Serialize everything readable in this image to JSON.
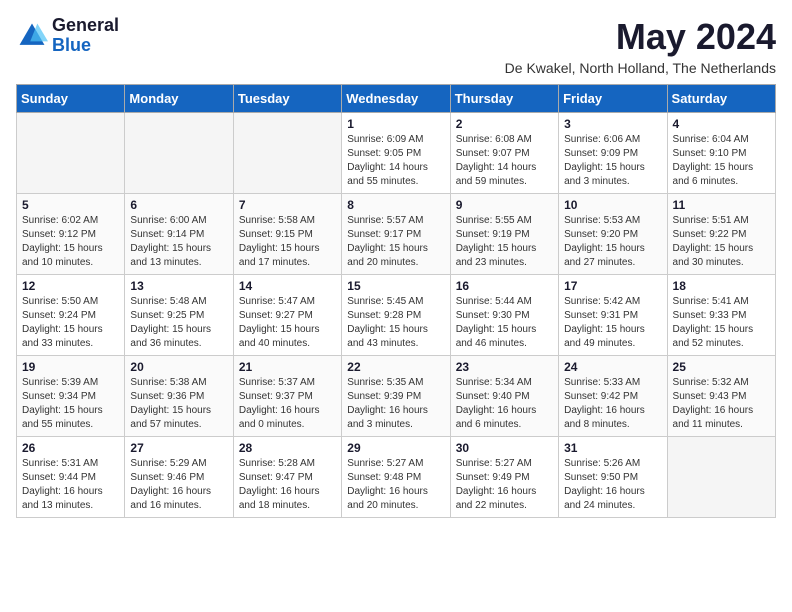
{
  "logo": {
    "general": "General",
    "blue": "Blue"
  },
  "title": "May 2024",
  "location": "De Kwakel, North Holland, The Netherlands",
  "days_of_week": [
    "Sunday",
    "Monday",
    "Tuesday",
    "Wednesday",
    "Thursday",
    "Friday",
    "Saturday"
  ],
  "weeks": [
    [
      {
        "day": "",
        "info": ""
      },
      {
        "day": "",
        "info": ""
      },
      {
        "day": "",
        "info": ""
      },
      {
        "day": "1",
        "info": "Sunrise: 6:09 AM\nSunset: 9:05 PM\nDaylight: 14 hours and 55 minutes."
      },
      {
        "day": "2",
        "info": "Sunrise: 6:08 AM\nSunset: 9:07 PM\nDaylight: 14 hours and 59 minutes."
      },
      {
        "day": "3",
        "info": "Sunrise: 6:06 AM\nSunset: 9:09 PM\nDaylight: 15 hours and 3 minutes."
      },
      {
        "day": "4",
        "info": "Sunrise: 6:04 AM\nSunset: 9:10 PM\nDaylight: 15 hours and 6 minutes."
      }
    ],
    [
      {
        "day": "5",
        "info": "Sunrise: 6:02 AM\nSunset: 9:12 PM\nDaylight: 15 hours and 10 minutes."
      },
      {
        "day": "6",
        "info": "Sunrise: 6:00 AM\nSunset: 9:14 PM\nDaylight: 15 hours and 13 minutes."
      },
      {
        "day": "7",
        "info": "Sunrise: 5:58 AM\nSunset: 9:15 PM\nDaylight: 15 hours and 17 minutes."
      },
      {
        "day": "8",
        "info": "Sunrise: 5:57 AM\nSunset: 9:17 PM\nDaylight: 15 hours and 20 minutes."
      },
      {
        "day": "9",
        "info": "Sunrise: 5:55 AM\nSunset: 9:19 PM\nDaylight: 15 hours and 23 minutes."
      },
      {
        "day": "10",
        "info": "Sunrise: 5:53 AM\nSunset: 9:20 PM\nDaylight: 15 hours and 27 minutes."
      },
      {
        "day": "11",
        "info": "Sunrise: 5:51 AM\nSunset: 9:22 PM\nDaylight: 15 hours and 30 minutes."
      }
    ],
    [
      {
        "day": "12",
        "info": "Sunrise: 5:50 AM\nSunset: 9:24 PM\nDaylight: 15 hours and 33 minutes."
      },
      {
        "day": "13",
        "info": "Sunrise: 5:48 AM\nSunset: 9:25 PM\nDaylight: 15 hours and 36 minutes."
      },
      {
        "day": "14",
        "info": "Sunrise: 5:47 AM\nSunset: 9:27 PM\nDaylight: 15 hours and 40 minutes."
      },
      {
        "day": "15",
        "info": "Sunrise: 5:45 AM\nSunset: 9:28 PM\nDaylight: 15 hours and 43 minutes."
      },
      {
        "day": "16",
        "info": "Sunrise: 5:44 AM\nSunset: 9:30 PM\nDaylight: 15 hours and 46 minutes."
      },
      {
        "day": "17",
        "info": "Sunrise: 5:42 AM\nSunset: 9:31 PM\nDaylight: 15 hours and 49 minutes."
      },
      {
        "day": "18",
        "info": "Sunrise: 5:41 AM\nSunset: 9:33 PM\nDaylight: 15 hours and 52 minutes."
      }
    ],
    [
      {
        "day": "19",
        "info": "Sunrise: 5:39 AM\nSunset: 9:34 PM\nDaylight: 15 hours and 55 minutes."
      },
      {
        "day": "20",
        "info": "Sunrise: 5:38 AM\nSunset: 9:36 PM\nDaylight: 15 hours and 57 minutes."
      },
      {
        "day": "21",
        "info": "Sunrise: 5:37 AM\nSunset: 9:37 PM\nDaylight: 16 hours and 0 minutes."
      },
      {
        "day": "22",
        "info": "Sunrise: 5:35 AM\nSunset: 9:39 PM\nDaylight: 16 hours and 3 minutes."
      },
      {
        "day": "23",
        "info": "Sunrise: 5:34 AM\nSunset: 9:40 PM\nDaylight: 16 hours and 6 minutes."
      },
      {
        "day": "24",
        "info": "Sunrise: 5:33 AM\nSunset: 9:42 PM\nDaylight: 16 hours and 8 minutes."
      },
      {
        "day": "25",
        "info": "Sunrise: 5:32 AM\nSunset: 9:43 PM\nDaylight: 16 hours and 11 minutes."
      }
    ],
    [
      {
        "day": "26",
        "info": "Sunrise: 5:31 AM\nSunset: 9:44 PM\nDaylight: 16 hours and 13 minutes."
      },
      {
        "day": "27",
        "info": "Sunrise: 5:29 AM\nSunset: 9:46 PM\nDaylight: 16 hours and 16 minutes."
      },
      {
        "day": "28",
        "info": "Sunrise: 5:28 AM\nSunset: 9:47 PM\nDaylight: 16 hours and 18 minutes."
      },
      {
        "day": "29",
        "info": "Sunrise: 5:27 AM\nSunset: 9:48 PM\nDaylight: 16 hours and 20 minutes."
      },
      {
        "day": "30",
        "info": "Sunrise: 5:27 AM\nSunset: 9:49 PM\nDaylight: 16 hours and 22 minutes."
      },
      {
        "day": "31",
        "info": "Sunrise: 5:26 AM\nSunset: 9:50 PM\nDaylight: 16 hours and 24 minutes."
      },
      {
        "day": "",
        "info": ""
      }
    ]
  ]
}
